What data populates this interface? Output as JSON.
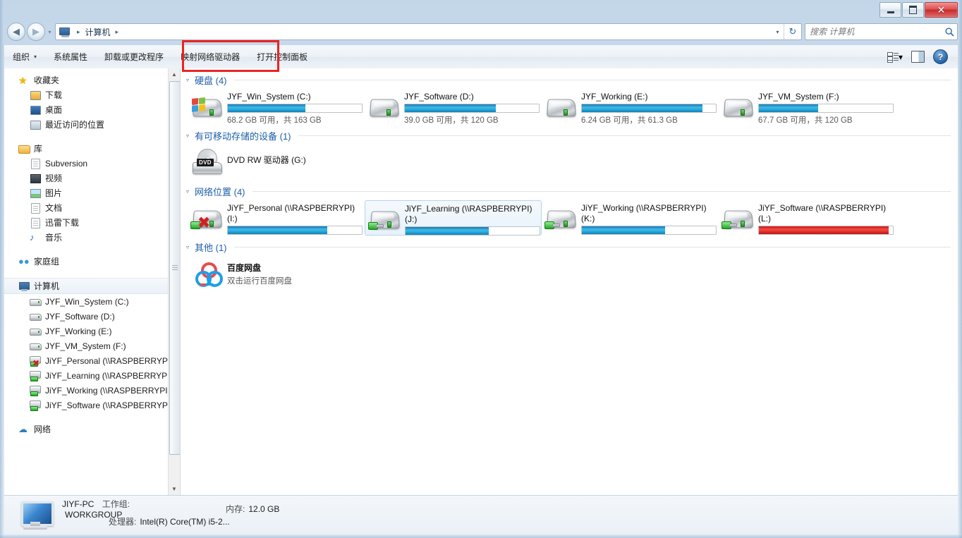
{
  "window": {
    "minimize_label": "–",
    "maximize_label": "▭",
    "close_label": "✕"
  },
  "address": {
    "back_glyph": "◀",
    "forward_glyph": "▶",
    "dropdown_glyph": "▾",
    "refresh_glyph": "↻",
    "crumbs": [
      "计算机"
    ],
    "separator": "▸"
  },
  "search": {
    "placeholder": "搜索 计算机",
    "icon_glyph": "⚲"
  },
  "toolbar": {
    "organize": "组织",
    "organize_caret": "▾",
    "system_properties": "系统属性",
    "uninstall_program": "卸载或更改程序",
    "map_network_drive": "映射网络驱动器",
    "open_control_panel": "打开控制面板",
    "views_caret": "▾",
    "help_glyph": "?"
  },
  "navpane": {
    "favorites": {
      "label": "收藏夹",
      "icon": "star-icon",
      "items": [
        {
          "label": "下载",
          "icon": "download-icon"
        },
        {
          "label": "桌面",
          "icon": "desktop-icon"
        },
        {
          "label": "最近访问的位置",
          "icon": "recent-places-icon"
        }
      ]
    },
    "libraries": {
      "label": "库",
      "icon": "library-icon",
      "items": [
        {
          "label": "Subversion",
          "icon": "document-icon"
        },
        {
          "label": "视频",
          "icon": "video-icon"
        },
        {
          "label": "图片",
          "icon": "picture-icon"
        },
        {
          "label": "文档",
          "icon": "document-icon"
        },
        {
          "label": "迅雷下载",
          "icon": "document-icon"
        },
        {
          "label": "音乐",
          "icon": "music-icon"
        }
      ]
    },
    "homegroup": {
      "label": "家庭组",
      "icon": "homegroup-icon"
    },
    "computer": {
      "label": "计算机",
      "icon": "computer-icon",
      "selected": true,
      "items": [
        {
          "label": "JYF_Win_System (C:)",
          "icon": "drive-windows-icon"
        },
        {
          "label": "JYF_Software (D:)",
          "icon": "drive-icon"
        },
        {
          "label": "JYF_Working (E:)",
          "icon": "drive-icon"
        },
        {
          "label": "JYF_VM_System (F:)",
          "icon": "drive-icon"
        },
        {
          "label": "JiYF_Personal (\\\\RASPBERRYPI) (I",
          "icon": "network-drive-disconnected-icon"
        },
        {
          "label": "JiYF_Learning (\\\\RASPBERRYPI) (J",
          "icon": "network-drive-icon"
        },
        {
          "label": "JiYF_Working (\\\\RASPBERRYPI) (K",
          "icon": "network-drive-icon"
        },
        {
          "label": "JiYF_Software (\\\\RASPBERRYPI) (L",
          "icon": "network-drive-icon"
        }
      ]
    },
    "network": {
      "label": "网络",
      "icon": "network-icon"
    },
    "scroll_up_glyph": "▲",
    "scroll_down_glyph": "▼"
  },
  "main": {
    "sections": [
      {
        "title": "硬盘 (4)",
        "caret": "▿",
        "name": "hard-disks",
        "items": [
          {
            "name": "JYF_Win_System (C:)",
            "icon": "drive-windows-icon",
            "bar_percent": 58,
            "bar_color": "#2fb3e6",
            "detail": "68.2 GB 可用，共 163 GB",
            "free": "68.2 GB",
            "total": "163 GB"
          },
          {
            "name": "JYF_Software (D:)",
            "icon": "drive-icon",
            "bar_percent": 68,
            "bar_color": "#2fb3e6",
            "detail": "39.0 GB 可用，共 120 GB",
            "free": "39.0 GB",
            "total": "120 GB"
          },
          {
            "name": "JYF_Working (E:)",
            "icon": "drive-icon",
            "bar_percent": 90,
            "bar_color": "#2fb3e6",
            "detail": "6.24 GB 可用，共 61.3 GB",
            "free": "6.24 GB",
            "total": "61.3 GB"
          },
          {
            "name": "JYF_VM_System (F:)",
            "icon": "drive-icon",
            "bar_percent": 44,
            "bar_color": "#2fb3e6",
            "detail": "67.7 GB 可用，共 120 GB",
            "free": "67.7 GB",
            "total": "120 GB"
          }
        ]
      },
      {
        "title": "有可移动存储的设备 (1)",
        "caret": "▿",
        "name": "removable-storage",
        "items": [
          {
            "name": "DVD RW 驱动器 (G:)",
            "icon": "dvd-drive-icon",
            "bar_percent": null,
            "detail": ""
          }
        ]
      },
      {
        "title": "网络位置 (4)",
        "caret": "▿",
        "name": "network-locations",
        "items": [
          {
            "name": "JiYF_Personal (\\\\RASPBERRYPI) (I:)",
            "icon": "network-drive-disconnected-icon",
            "bar_percent": 74,
            "bar_color": "#2fb3e6",
            "detail": ""
          },
          {
            "name": "JiYF_Learning (\\\\RASPBERRYPI) (J:)",
            "icon": "network-drive-icon",
            "bar_percent": 62,
            "bar_color": "#2fb3e6",
            "detail": "",
            "selected": true
          },
          {
            "name": "JiYF_Working (\\\\RASPBERRYPI) (K:)",
            "icon": "network-drive-icon",
            "bar_percent": 62,
            "bar_color": "#2fb3e6",
            "detail": ""
          },
          {
            "name": "JiYF_Software (\\\\RASPBERRYPI) (L:)",
            "icon": "network-drive-icon",
            "bar_percent": 97,
            "bar_color": "#ef3b34",
            "detail": ""
          }
        ]
      },
      {
        "title": "其他 (1)",
        "caret": "▿",
        "name": "other",
        "items": [
          {
            "name": "百度网盘",
            "icon": "baidu-netdisk-icon",
            "bar_percent": null,
            "detail": "双击运行百度网盘"
          }
        ]
      }
    ]
  },
  "statusbar": {
    "computer_name": "JIYF-PC",
    "workgroup_label": "工作组:",
    "workgroup_value": "WORKGROUP",
    "memory_label": "内存:",
    "memory_value": "12.0 GB",
    "processor_label": "处理器:",
    "processor_value": "Intel(R) Core(TM) i5-2..."
  },
  "annotation": {
    "color": "#ee2222",
    "target": "map-network-drive-button"
  }
}
